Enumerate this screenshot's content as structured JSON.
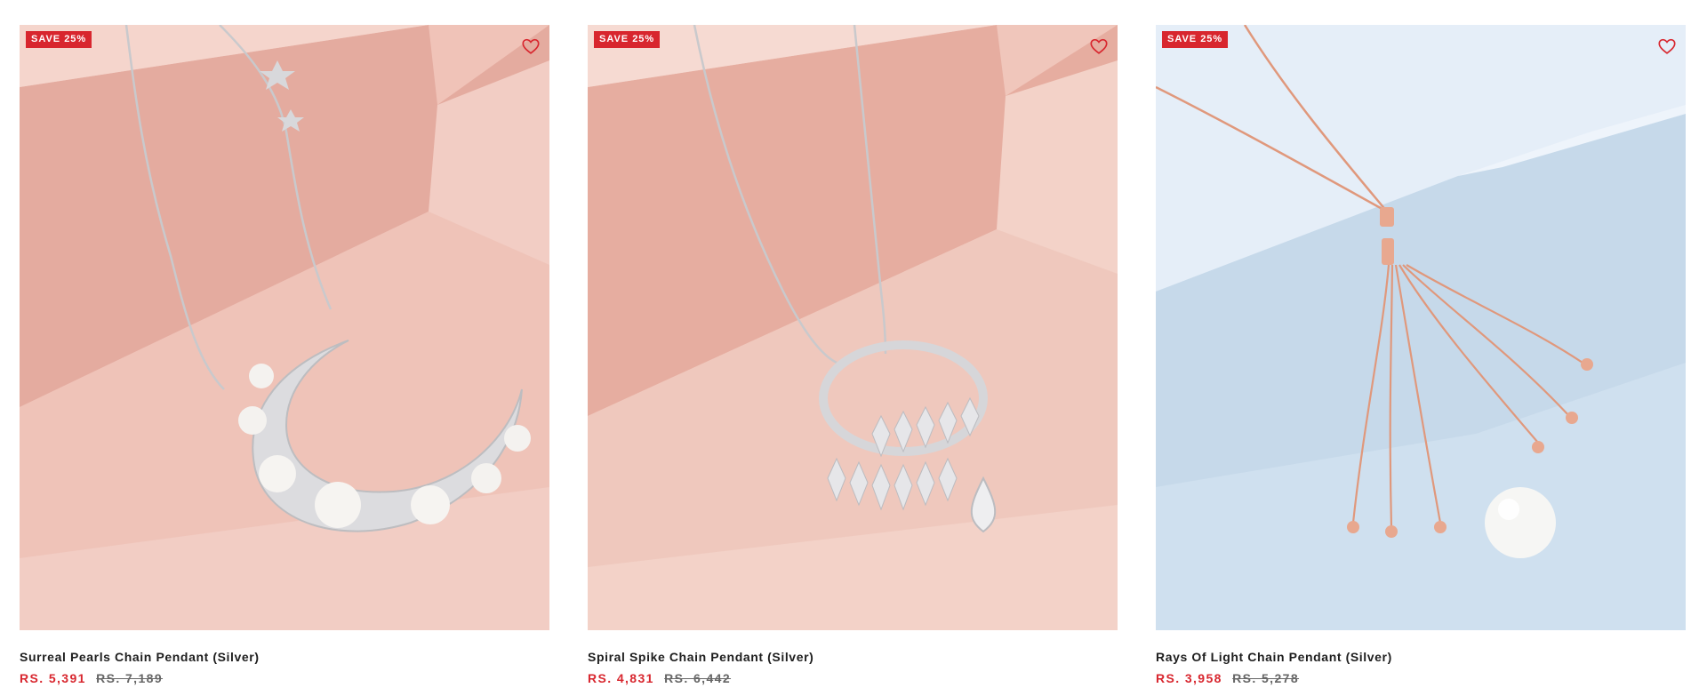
{
  "products": [
    {
      "badge": "SAVE 25%",
      "title": "Surreal Pearls Chain Pendant (Silver)",
      "price_sale": "RS. 5,391",
      "price_original": "RS. 7,189",
      "wishlist_icon": "heart-outline-icon",
      "image_subject": "crescent-pearl-pendant",
      "colors": {
        "bg": "#f2cdc4",
        "block_front": "#e6aea2",
        "block_top": "#f6d8d0",
        "metal": "#d9d9dc"
      }
    },
    {
      "badge": "SAVE 25%",
      "title": "Spiral Spike Chain Pendant (Silver)",
      "price_sale": "RS. 4,831",
      "price_original": "RS. 6,442",
      "wishlist_icon": "heart-outline-icon",
      "image_subject": "spiral-spike-pendant",
      "colors": {
        "bg": "#f3d2c8",
        "block_front": "#e7b0a3",
        "block_top": "#f7ddd5",
        "metal": "#dcdcdf"
      }
    },
    {
      "badge": "SAVE 25%",
      "title": "Rays Of Light Chain Pendant (Silver)",
      "price_sale": "RS. 3,958",
      "price_original": "RS. 5,278",
      "wishlist_icon": "heart-outline-icon",
      "image_subject": "tassel-pearl-pendant",
      "colors": {
        "bg": "#d2e2f0",
        "block_front": "#eef4fa",
        "block_top": "#e4eef8",
        "metal": "#e09a80"
      }
    }
  ],
  "accent_color": "#d8262e"
}
